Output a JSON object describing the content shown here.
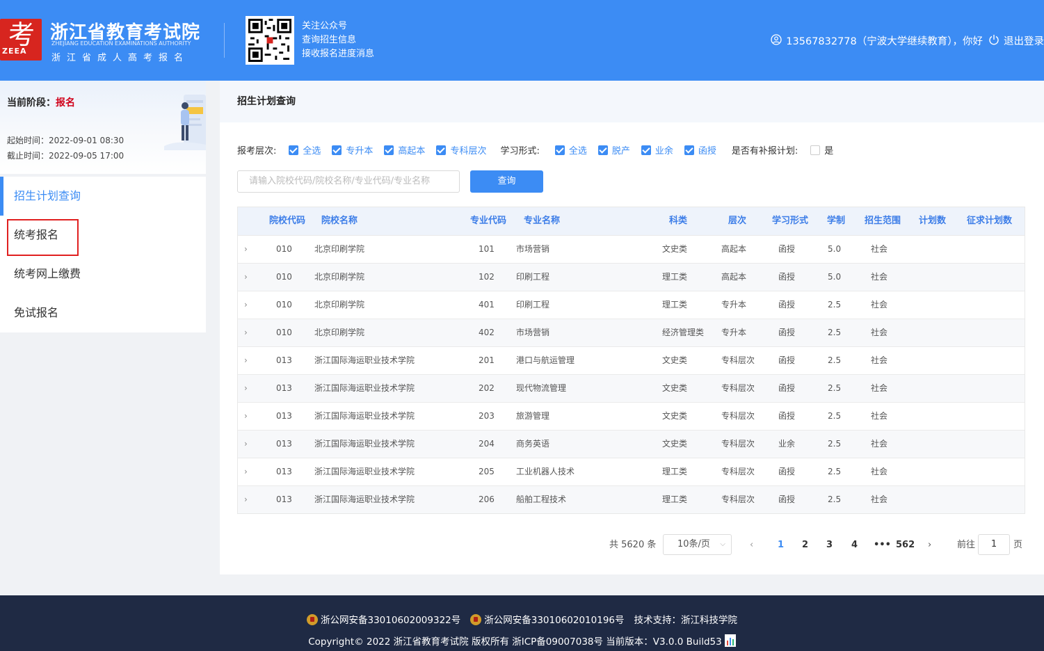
{
  "header": {
    "logo_glyph": "考",
    "logo_abbr": "ZEEA",
    "logo_tiny": "Zhejiang Education Examinations Authority",
    "title": "浙江省教育考试院",
    "title_en": "ZHEJIANG EDUCATION EXAMINATIONS AUTHORITY",
    "subtitle": "浙江省成人高考报名",
    "qr_lines": [
      "关注公众号",
      "查询招生信息",
      "接收报名进度消息"
    ],
    "user_text": "13567832778（宁波大学继续教育），你好",
    "logout_label": "退出登录"
  },
  "stage": {
    "label": "当前阶段：",
    "value": "报名",
    "start": "起始时间：2022-09-01 08:30",
    "end": "截止时间：2022-09-05 17:00"
  },
  "menu": [
    {
      "label": "招生计划查询",
      "active": true
    },
    {
      "label": "统考报名",
      "highlighted": true
    },
    {
      "label": "统考网上缴费"
    },
    {
      "label": "免试报名"
    }
  ],
  "main": {
    "title": "招生计划查询",
    "filters": {
      "level_label": "报考层次:",
      "level_options": [
        "全选",
        "专升本",
        "高起本",
        "专科层次"
      ],
      "form_label": "学习形式:",
      "form_options": [
        "全选",
        "脱产",
        "业余",
        "函授"
      ],
      "supp_label": "是否有补报计划:",
      "supp_option": "是"
    },
    "search_placeholder": "请输入院校代码/院校名称/专业代码/专业名称",
    "search_button": "查询"
  },
  "table": {
    "columns": [
      "院校代码",
      "院校名称",
      "专业代码",
      "专业名称",
      "科类",
      "层次",
      "学习形式",
      "学制",
      "招生范围",
      "计划数",
      "征求计划数"
    ],
    "rows": [
      [
        "010",
        "北京印刷学院",
        "101",
        "市场营销",
        "文史类",
        "高起本",
        "函授",
        "5.0",
        "社会"
      ],
      [
        "010",
        "北京印刷学院",
        "102",
        "印刷工程",
        "理工类",
        "高起本",
        "函授",
        "5.0",
        "社会"
      ],
      [
        "010",
        "北京印刷学院",
        "401",
        "印刷工程",
        "理工类",
        "专升本",
        "函授",
        "2.5",
        "社会"
      ],
      [
        "010",
        "北京印刷学院",
        "402",
        "市场营销",
        "经济管理类",
        "专升本",
        "函授",
        "2.5",
        "社会"
      ],
      [
        "013",
        "浙江国际海运职业技术学院",
        "201",
        "港口与航运管理",
        "文史类",
        "专科层次",
        "函授",
        "2.5",
        "社会"
      ],
      [
        "013",
        "浙江国际海运职业技术学院",
        "202",
        "现代物流管理",
        "文史类",
        "专科层次",
        "函授",
        "2.5",
        "社会"
      ],
      [
        "013",
        "浙江国际海运职业技术学院",
        "203",
        "旅游管理",
        "文史类",
        "专科层次",
        "函授",
        "2.5",
        "社会"
      ],
      [
        "013",
        "浙江国际海运职业技术学院",
        "204",
        "商务英语",
        "文史类",
        "专科层次",
        "业余",
        "2.5",
        "社会"
      ],
      [
        "013",
        "浙江国际海运职业技术学院",
        "205",
        "工业机器人技术",
        "理工类",
        "专科层次",
        "函授",
        "2.5",
        "社会"
      ],
      [
        "013",
        "浙江国际海运职业技术学院",
        "206",
        "船舶工程技术",
        "理工类",
        "专科层次",
        "函授",
        "2.5",
        "社会"
      ]
    ]
  },
  "pagination": {
    "total": "共 5620 条",
    "page_size": "10条/页",
    "pages": [
      "1",
      "2",
      "3",
      "4",
      "•••",
      "562"
    ],
    "current": "1",
    "goto_label": "前往",
    "goto_value": "1",
    "page_suffix": "页"
  },
  "footer": {
    "beian1": "浙公网安备33010602009322号",
    "beian2": "浙公网安备33010602010196号",
    "support": "技术支持：浙江科技学院",
    "copyright": "Copyright© 2022 浙江省教育考试院 版权所有 浙ICP备09007038号 当前版本：V3.0.0 Build53"
  },
  "colors": {
    "primary": "#3c8cf4",
    "stage_value": "#d0021b",
    "highlight_box": "#e02020",
    "footer_bg": "#1f2a44"
  },
  "icons": {
    "user": "user-circle-icon",
    "logout": "power-icon",
    "row_expand": "chevron-right-icon",
    "police_badge": "police-badge-icon"
  }
}
